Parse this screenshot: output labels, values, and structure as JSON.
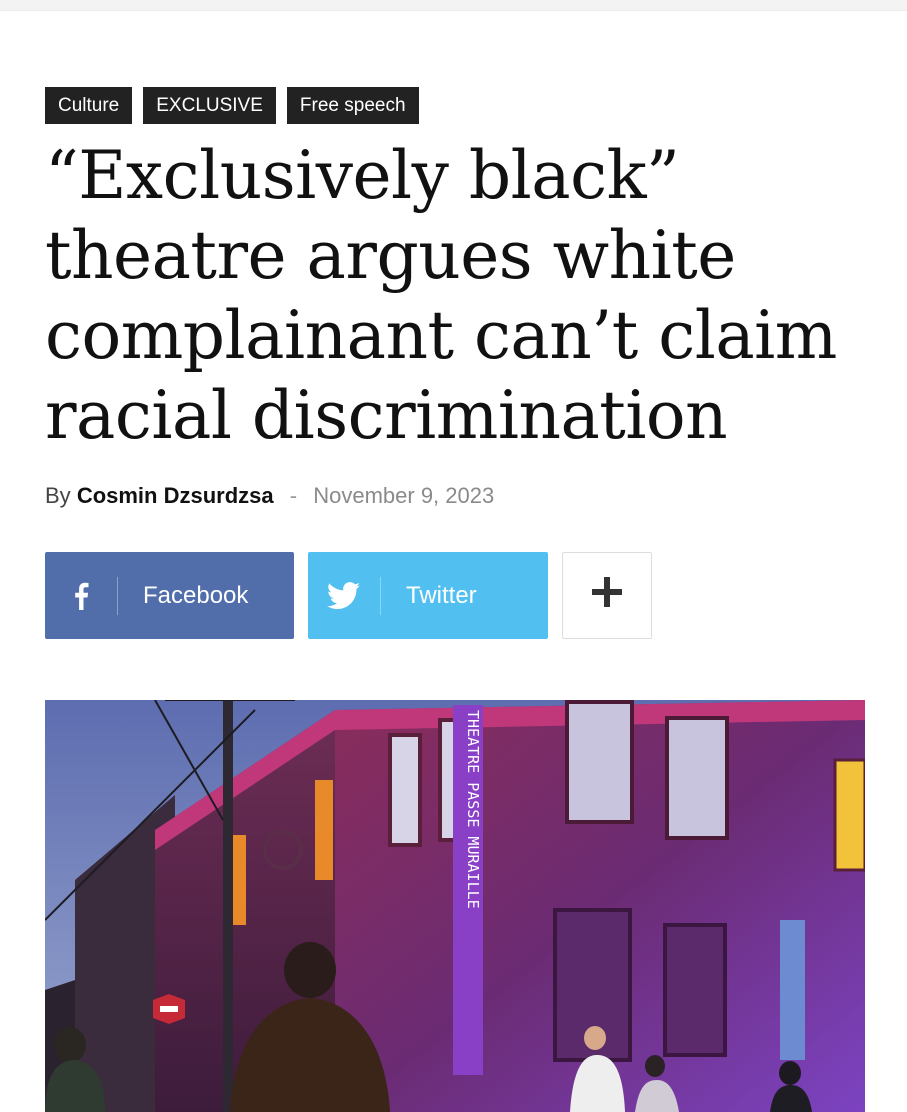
{
  "tags": [
    "Culture",
    "EXCLUSIVE",
    "Free speech"
  ],
  "article": {
    "headline": "“Exclusively black” theatre argues white complainant can’t claim racial discrimination",
    "byline_prefix": "By",
    "author": "Cosmin Dzsurdzsa",
    "separator": "-",
    "date": "November 9, 2023"
  },
  "share": {
    "facebook_label": "Facebook",
    "twitter_label": "Twitter",
    "more_icon": "plus-icon",
    "facebook_icon": "facebook-icon",
    "twitter_icon": "twitter-bird-icon"
  },
  "hero_image": {
    "sign_text": "THEATRE PASSE MURAILLE"
  },
  "colors": {
    "tag_bg": "#222222",
    "facebook": "#516eab",
    "twitter": "#51bff0"
  }
}
